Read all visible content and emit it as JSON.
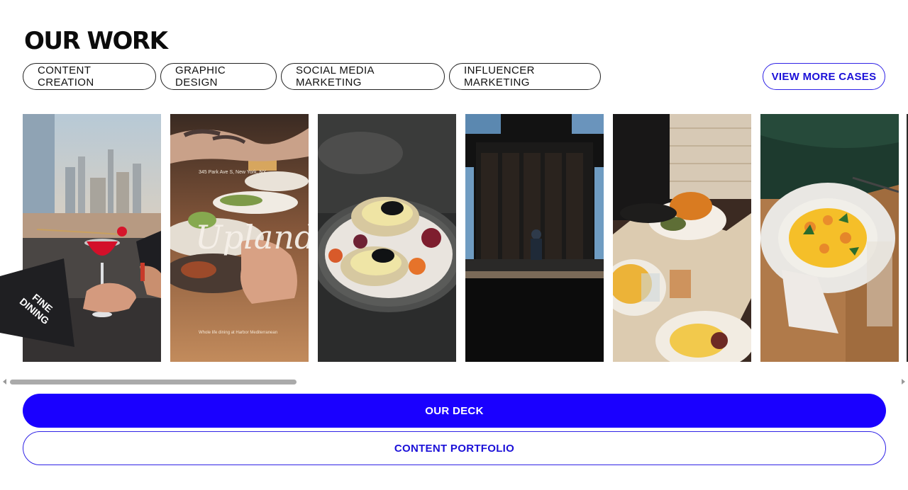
{
  "section": {
    "title": "OUR WORK"
  },
  "tags": [
    {
      "label": "CONTENT CREATION"
    },
    {
      "label": "GRAPHIC DESIGN"
    },
    {
      "label": "SOCIAL MEDIA MARKETING"
    },
    {
      "label": "INFLUENCER MARKETING"
    }
  ],
  "view_more": {
    "label": "VIEW MORE CASES"
  },
  "gallery": {
    "badge": "FINE\nDINING",
    "upland": {
      "script": "Upland",
      "address": "345 Park Ave S, New York, NY",
      "tagline": "Whole life dining at Harbor Mediterranean"
    }
  },
  "buttons": {
    "deck": "OUR DECK",
    "portfolio": "CONTENT PORTFOLIO"
  },
  "colors": {
    "accent": "#1a00ff",
    "accent_text": "#1b10d8"
  }
}
